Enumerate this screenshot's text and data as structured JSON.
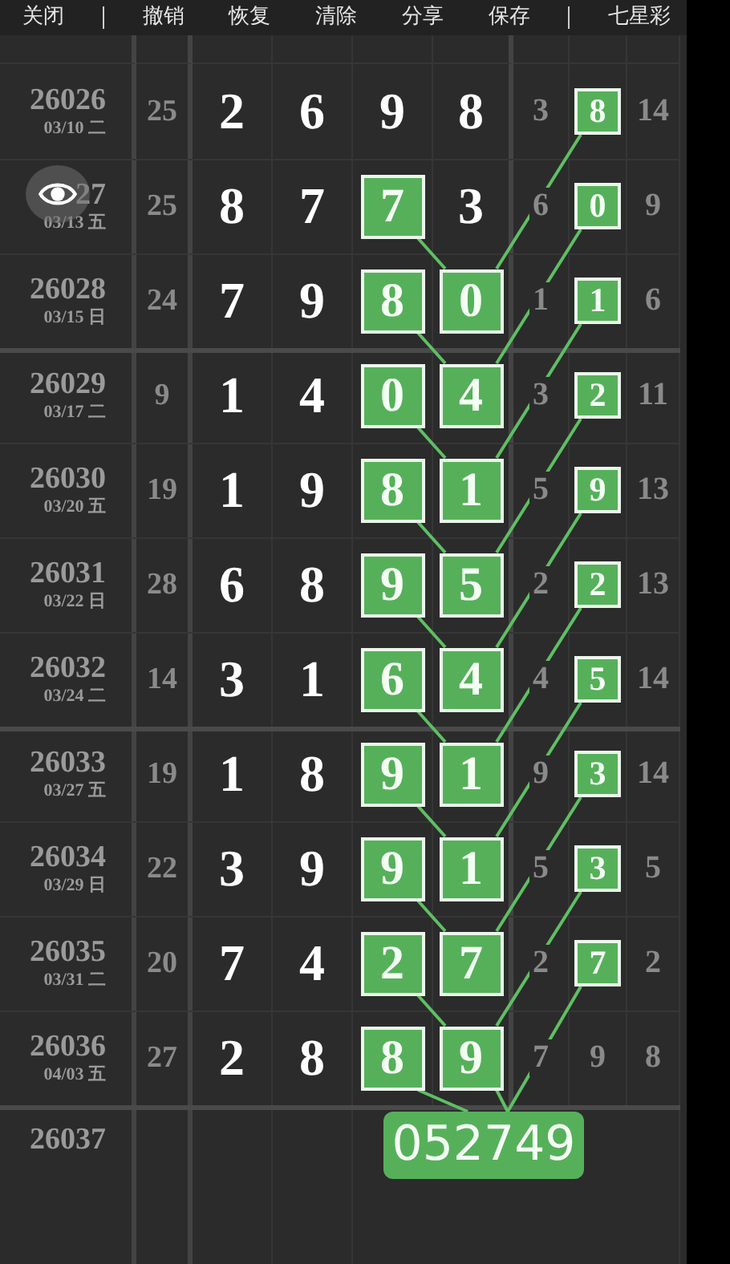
{
  "toolbar": [
    {
      "label": "关闭",
      "divider_after": true
    },
    {
      "label": "撤销",
      "divider_after": false
    },
    {
      "label": "恢复",
      "divider_after": false
    },
    {
      "label": "清除",
      "divider_after": false
    },
    {
      "label": "分享",
      "divider_after": false
    },
    {
      "label": "保存",
      "divider_after": true
    },
    {
      "label": "七星彩",
      "divider_after": false
    }
  ],
  "rows": [
    {
      "issue": "26026",
      "date": "03/10 二",
      "sum": "25",
      "digits": [
        {
          "text": "2",
          "boxed": false
        },
        {
          "text": "6",
          "boxed": false
        },
        {
          "text": "9",
          "boxed": false
        },
        {
          "text": "8",
          "boxed": false
        }
      ],
      "tail": [
        {
          "text": "3",
          "boxed": false
        },
        {
          "text": "8",
          "boxed": true
        },
        {
          "text": "14",
          "boxed": false
        }
      ],
      "group_end": false
    },
    {
      "issue": "27",
      "date": "03/13 五",
      "sum": "25",
      "digits": [
        {
          "text": "8",
          "boxed": false
        },
        {
          "text": "7",
          "boxed": false
        },
        {
          "text": "7",
          "boxed": true
        },
        {
          "text": "3",
          "boxed": false
        }
      ],
      "tail": [
        {
          "text": "6",
          "boxed": false
        },
        {
          "text": "0",
          "boxed": true
        },
        {
          "text": "9",
          "boxed": false
        }
      ],
      "group_end": false
    },
    {
      "issue": "26028",
      "date": "03/15 日",
      "sum": "24",
      "digits": [
        {
          "text": "7",
          "boxed": false
        },
        {
          "text": "9",
          "boxed": false
        },
        {
          "text": "8",
          "boxed": true
        },
        {
          "text": "0",
          "boxed": true
        }
      ],
      "tail": [
        {
          "text": "1",
          "boxed": false
        },
        {
          "text": "1",
          "boxed": true
        },
        {
          "text": "6",
          "boxed": false
        }
      ],
      "group_end": true
    },
    {
      "issue": "26029",
      "date": "03/17 二",
      "sum": "9",
      "digits": [
        {
          "text": "1",
          "boxed": false
        },
        {
          "text": "4",
          "boxed": false
        },
        {
          "text": "0",
          "boxed": true
        },
        {
          "text": "4",
          "boxed": true
        }
      ],
      "tail": [
        {
          "text": "3",
          "boxed": false
        },
        {
          "text": "2",
          "boxed": true
        },
        {
          "text": "11",
          "boxed": false
        }
      ],
      "group_end": false
    },
    {
      "issue": "26030",
      "date": "03/20 五",
      "sum": "19",
      "digits": [
        {
          "text": "1",
          "boxed": false
        },
        {
          "text": "9",
          "boxed": false
        },
        {
          "text": "8",
          "boxed": true
        },
        {
          "text": "1",
          "boxed": true
        }
      ],
      "tail": [
        {
          "text": "5",
          "boxed": false
        },
        {
          "text": "9",
          "boxed": true
        },
        {
          "text": "13",
          "boxed": false
        }
      ],
      "group_end": false
    },
    {
      "issue": "26031",
      "date": "03/22 日",
      "sum": "28",
      "digits": [
        {
          "text": "6",
          "boxed": false
        },
        {
          "text": "8",
          "boxed": false
        },
        {
          "text": "9",
          "boxed": true
        },
        {
          "text": "5",
          "boxed": true
        }
      ],
      "tail": [
        {
          "text": "2",
          "boxed": false
        },
        {
          "text": "2",
          "boxed": true
        },
        {
          "text": "13",
          "boxed": false
        }
      ],
      "group_end": false
    },
    {
      "issue": "26032",
      "date": "03/24 二",
      "sum": "14",
      "digits": [
        {
          "text": "3",
          "boxed": false
        },
        {
          "text": "1",
          "boxed": false
        },
        {
          "text": "6",
          "boxed": true
        },
        {
          "text": "4",
          "boxed": true
        }
      ],
      "tail": [
        {
          "text": "4",
          "boxed": false
        },
        {
          "text": "5",
          "boxed": true
        },
        {
          "text": "14",
          "boxed": false
        }
      ],
      "group_end": true
    },
    {
      "issue": "26033",
      "date": "03/27 五",
      "sum": "19",
      "digits": [
        {
          "text": "1",
          "boxed": false
        },
        {
          "text": "8",
          "boxed": false
        },
        {
          "text": "9",
          "boxed": true
        },
        {
          "text": "1",
          "boxed": true
        }
      ],
      "tail": [
        {
          "text": "9",
          "boxed": false
        },
        {
          "text": "3",
          "boxed": true
        },
        {
          "text": "14",
          "boxed": false
        }
      ],
      "group_end": false
    },
    {
      "issue": "26034",
      "date": "03/29 日",
      "sum": "22",
      "digits": [
        {
          "text": "3",
          "boxed": false
        },
        {
          "text": "9",
          "boxed": false
        },
        {
          "text": "9",
          "boxed": true
        },
        {
          "text": "1",
          "boxed": true
        }
      ],
      "tail": [
        {
          "text": "5",
          "boxed": false
        },
        {
          "text": "3",
          "boxed": true
        },
        {
          "text": "5",
          "boxed": false
        }
      ],
      "group_end": false
    },
    {
      "issue": "26035",
      "date": "03/31 二",
      "sum": "20",
      "digits": [
        {
          "text": "7",
          "boxed": false
        },
        {
          "text": "4",
          "boxed": false
        },
        {
          "text": "2",
          "boxed": true
        },
        {
          "text": "7",
          "boxed": true
        }
      ],
      "tail": [
        {
          "text": "2",
          "boxed": false
        },
        {
          "text": "7",
          "boxed": true
        },
        {
          "text": "2",
          "boxed": false
        }
      ],
      "group_end": false
    },
    {
      "issue": "26036",
      "date": "04/03 五",
      "sum": "27",
      "digits": [
        {
          "text": "2",
          "boxed": false
        },
        {
          "text": "8",
          "boxed": false
        },
        {
          "text": "8",
          "boxed": true
        },
        {
          "text": "9",
          "boxed": true
        }
      ],
      "tail": [
        {
          "text": "7",
          "boxed": false
        },
        {
          "text": "9",
          "boxed": false
        },
        {
          "text": "8",
          "boxed": false
        }
      ],
      "group_end": true
    }
  ],
  "next": {
    "issue": "26037",
    "prediction": "052749"
  }
}
